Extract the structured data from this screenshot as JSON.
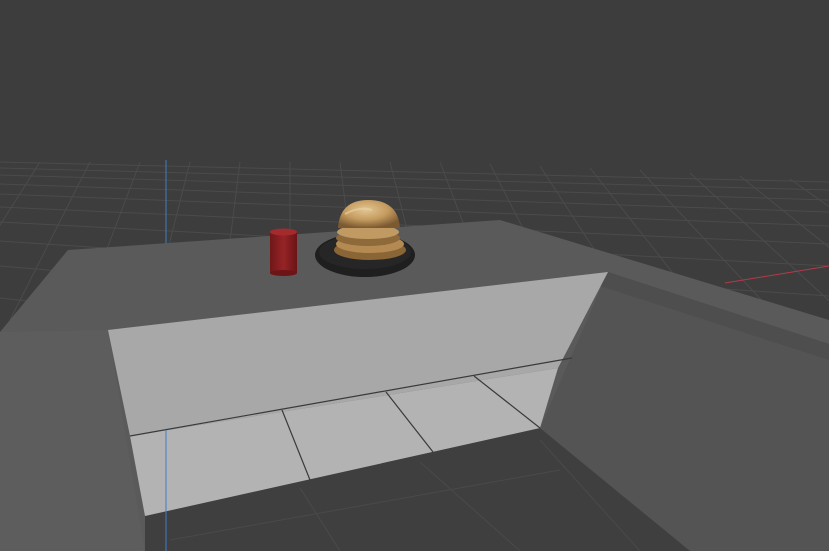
{
  "viewport": {
    "type": "3d-scene-viewport",
    "colors": {
      "background": "#3d3d3d",
      "grid": "#4a4a4a",
      "axis_x": "#b53a4a",
      "axis_y": "#3f7fc4",
      "table_top": "#5a5a5a",
      "table_front": "#a7a7a7",
      "table_front_lower": "#b4b4b4",
      "side_wall": "#545454",
      "cup": "#8b1f22",
      "plate": "#1f1f1f",
      "burger": "#c8a46e"
    },
    "objects": [
      "table",
      "red-cup",
      "plate",
      "burger",
      "ground-grid"
    ]
  }
}
